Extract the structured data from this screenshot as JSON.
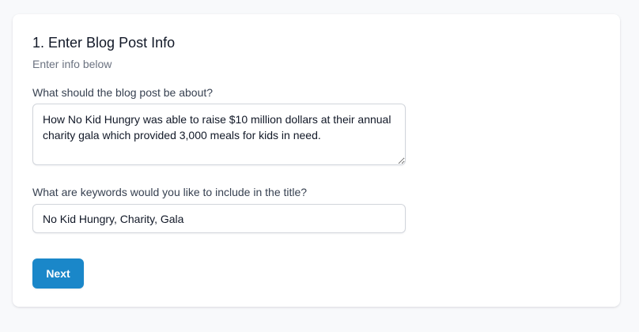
{
  "step": {
    "title": "1. Enter Blog Post Info",
    "subtitle": "Enter info below"
  },
  "fields": {
    "about": {
      "label": "What should the blog post be about?",
      "value": "How No Kid Hungry was able to raise $10 million dollars at their annual charity gala which provided 3,000 meals for kids in need.",
      "placeholder": ""
    },
    "keywords": {
      "label": "What are keywords would you like to include in the title?",
      "value": "No Kid Hungry, Charity, Gala",
      "placeholder": ""
    }
  },
  "actions": {
    "next_label": "Next"
  },
  "colors": {
    "accent": "#1a87c9",
    "background": "#f8f9fb",
    "card": "#ffffff"
  }
}
